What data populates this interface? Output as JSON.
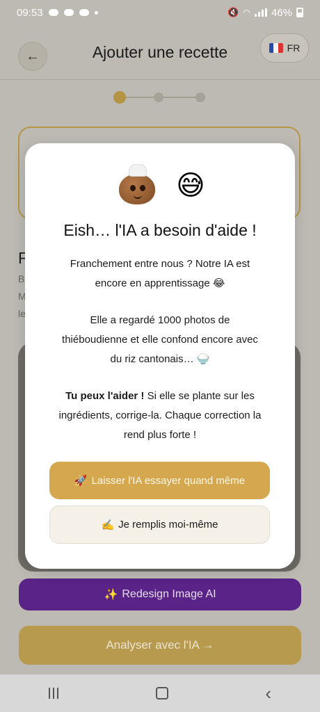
{
  "status_bar": {
    "time": "09:53",
    "battery": "46%"
  },
  "header": {
    "back_label": "←",
    "title": "Ajouter une recette",
    "lang_code": "FR"
  },
  "stepper": {
    "current": 1,
    "total": 3
  },
  "background": {
    "heading_fragment": "F",
    "line1": "B",
    "line2": "M",
    "line3": "le",
    "redesign_icon": "✨",
    "redesign_label": "Redesign Image AI",
    "analyse_label": "Analyser avec l'IA →"
  },
  "modal": {
    "emoji_face": "😅",
    "title": "Eish… l'IA a besoin d'aide !",
    "p1_line1": "Franchement entre nous ? Notre IA est",
    "p1_line2": "encore en apprentissage 😂",
    "p2_line1": "Elle a regardé 1000 photos de",
    "p2_line2": "thiéboudienne et elle confond encore avec",
    "p2_line3": "du riz cantonais… 🍚",
    "p3_bold": "Tu peux l'aider !",
    "p3_rest1": " Si elle se plante sur les",
    "p3_line2": "ingrédients, corrige-la. Chaque correction la",
    "p3_line3": "rend plus forte !",
    "try_icon": "🚀",
    "try_label": "Laisser l'IA essayer quand même",
    "self_icon": "✍️",
    "self_label": "Je remplis moi-même"
  },
  "colors": {
    "gold": "#d5a84f",
    "purple": "#5a2387",
    "overlay": "#bdbab4"
  }
}
